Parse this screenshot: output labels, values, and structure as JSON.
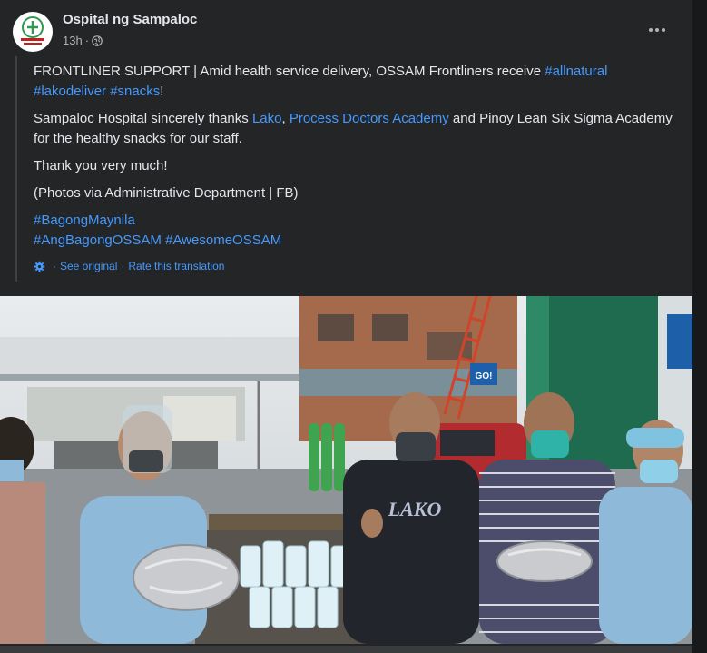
{
  "post": {
    "page_name": "Ospital ng Sampaloc",
    "time": "13h",
    "dot": "·",
    "privacy_icon": "globe-icon",
    "more_icon": "more-horizontal-icon"
  },
  "avatar": {
    "logo_text": "OSPITAL NG SAMPALOC",
    "logo_color": "#c21f1f",
    "logo_green": "#2e9a4e"
  },
  "content": {
    "p1_text": "FRONTLINER SUPPORT | Amid health service delivery, OSSAM Frontliners receive ",
    "p1_tag1": "#allnatural",
    "p1_tag2": "#lakodeliver",
    "p1_tag3": "#snacks",
    "p1_end": "!",
    "p2_a": "Sampaloc Hospital sincerely thanks ",
    "p2_link1": "Lako",
    "p2_b": ", ",
    "p2_link2": "Process Doctors Academy",
    "p2_c": " and Pinoy Lean Six Sigma Academy for the healthy snacks for our staff.",
    "p3": "Thank you very much!",
    "p4": "(Photos via Administrative Department | FB)",
    "tag_a": "#BagongMaynila",
    "tag_b": "#AngBagongOSSAM",
    "tag_c": "#AwesomeOSSAM"
  },
  "translation": {
    "see_original": "See original",
    "separator": "·",
    "rate": "Rate this translation",
    "icon": "gear-icon"
  },
  "photo": {
    "shirt_text": "LAKO",
    "sign_text": "GO!",
    "colors": {
      "link": "#4599ff",
      "card_bg": "#242526",
      "ppe_blue": "#8fb9d8",
      "green_pillar": "#1e6b50"
    }
  }
}
